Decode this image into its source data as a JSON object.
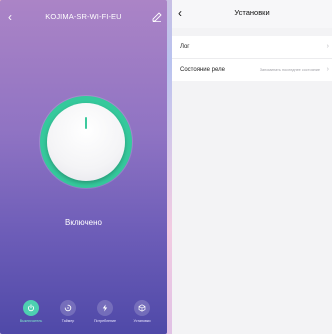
{
  "device": {
    "title": "KOJIMA-SR-WI-FI-EU",
    "state_text": "Включено",
    "accent_color": "#35c99c"
  },
  "nav": [
    {
      "label": "Выключатель",
      "icon": "power-icon",
      "active": true
    },
    {
      "label": "Таймер",
      "icon": "timer-icon",
      "active": false
    },
    {
      "label": "Потребление",
      "icon": "bolt-icon",
      "active": false
    },
    {
      "label": "Установки",
      "icon": "cube-icon",
      "active": false
    }
  ],
  "settings": {
    "title": "Установки",
    "rows": [
      {
        "label": "Лог",
        "value": ""
      },
      {
        "label": "Состояние реле",
        "value": "Запоминать последнее состояние"
      }
    ]
  }
}
